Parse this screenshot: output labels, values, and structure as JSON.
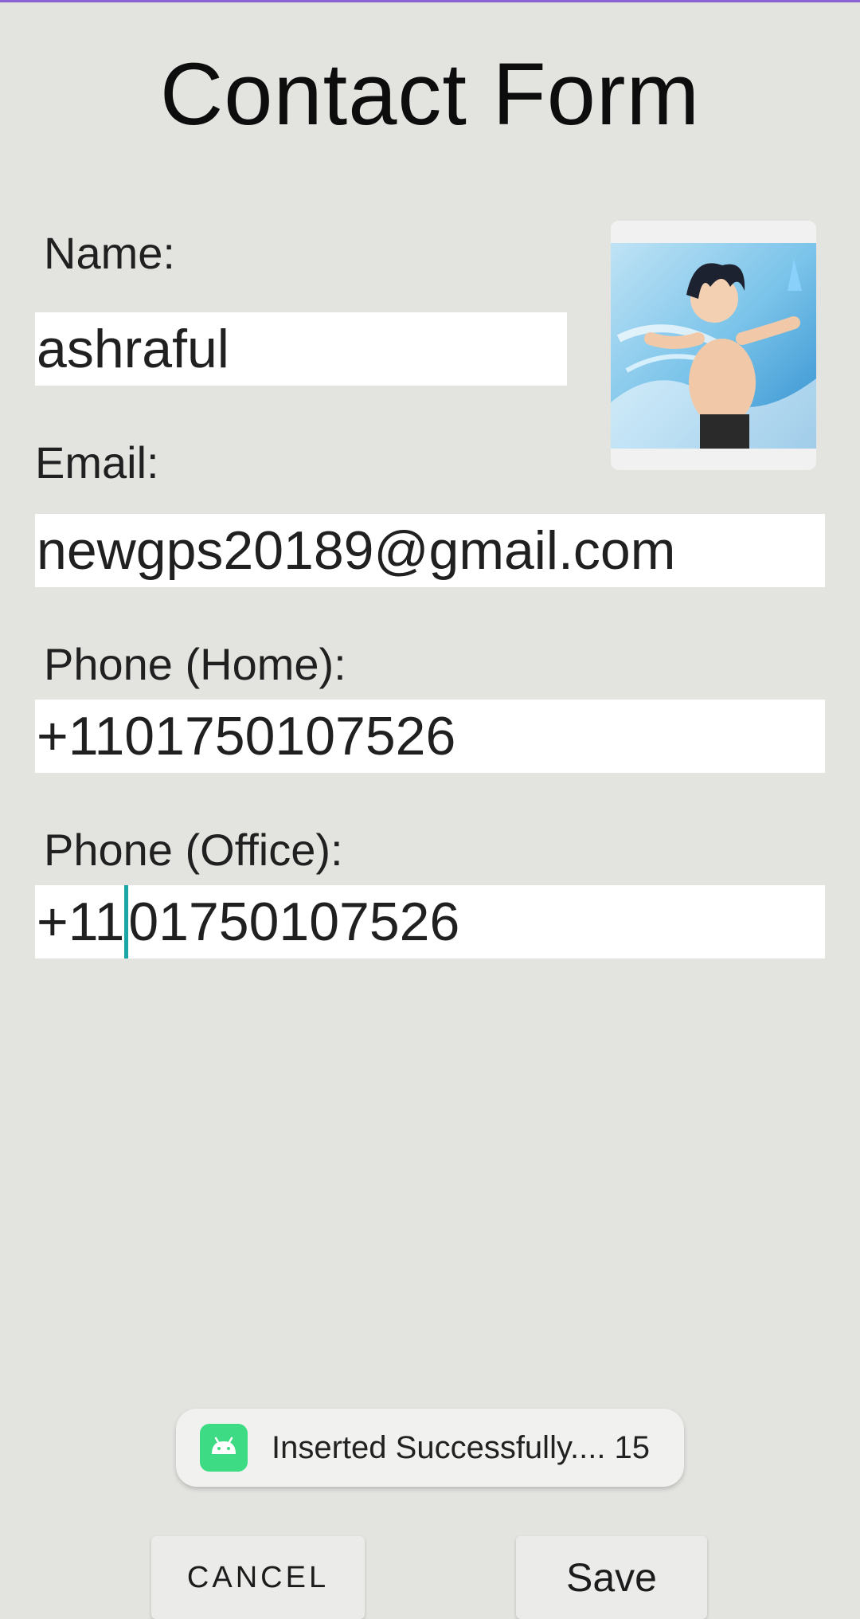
{
  "page": {
    "title": "Contact Form"
  },
  "form": {
    "name_label": "Name:",
    "name_value": "ashraful",
    "email_label": "Email:",
    "email_value": "newgps20189@gmail.com",
    "phone_home_label": "Phone (Home):",
    "phone_home_value": "+1101750107526",
    "phone_office_label": "Phone (Office):",
    "phone_office_value_before_caret": "+11",
    "phone_office_value_after_caret": "01750107526"
  },
  "toast": {
    "icon": "android-icon",
    "message": "Inserted Successfully.... 15"
  },
  "buttons": {
    "cancel_label": "CANCEL",
    "save_label": "Save"
  },
  "colors": {
    "background": "#e3e3e0",
    "caret": "#1aa6a6",
    "android_green": "#3ddc84"
  }
}
